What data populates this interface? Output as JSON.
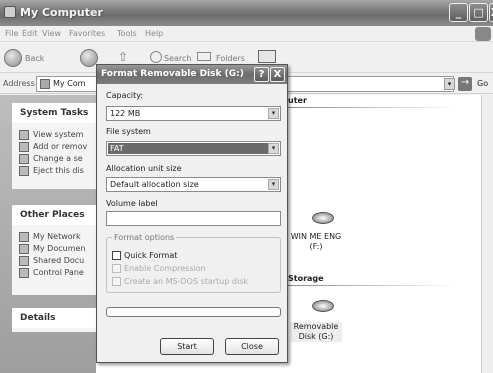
{
  "window": {
    "title": "My Computer",
    "minimize": "_",
    "maximize": "□",
    "close": "X"
  },
  "menu": [
    "File",
    "Edit",
    "View",
    "Favorites",
    "Tools",
    "Help"
  ],
  "toolbar": {
    "back_label": "Back",
    "search_label": "Search",
    "folders_label": "Folders"
  },
  "address": {
    "label": "Address",
    "value": "My Com",
    "go_label": "Go"
  },
  "left_pane": {
    "system_tasks": {
      "title": "System Tasks",
      "items": [
        "View system",
        "Add or remov",
        "Change a se",
        "Eject this dis"
      ]
    },
    "other_places": {
      "title": "Other Places",
      "items": [
        "My Network",
        "My Documen",
        "Shared Docu",
        "Control Pane"
      ]
    },
    "details": {
      "title": "Details"
    }
  },
  "content": {
    "group1_title": "uter",
    "group2_title": "Storage",
    "drives": [
      {
        "name": "WIN ME ENG (F:)",
        "line1": "WIN ME ENG",
        "line2": "(F:)"
      },
      {
        "name": "Removable Disk (G:)",
        "line1": "Removable",
        "line2": "Disk (G:)"
      }
    ]
  },
  "dialog": {
    "title": "Format Removable Disk (G:)",
    "help": "?",
    "close": "X",
    "capacity_label": "Capacity:",
    "capacity_value": "122 MB",
    "filesystem_label": "File system",
    "filesystem_value": "FAT",
    "allocation_label": "Allocation unit size",
    "allocation_value": "Default allocation size",
    "volume_label": "Volume label",
    "volume_value": "",
    "options_legend": "Format options",
    "options": [
      {
        "label": "Quick Format",
        "checked": false,
        "enabled": true
      },
      {
        "label": "Enable Compression",
        "checked": false,
        "enabled": false
      },
      {
        "label": "Create an MS-DOS startup disk",
        "checked": false,
        "enabled": false
      }
    ],
    "progress": 0,
    "start_label": "Start",
    "close_label": "Close"
  },
  "icons": {
    "dropdown": "▾",
    "go_arrow": "→"
  }
}
